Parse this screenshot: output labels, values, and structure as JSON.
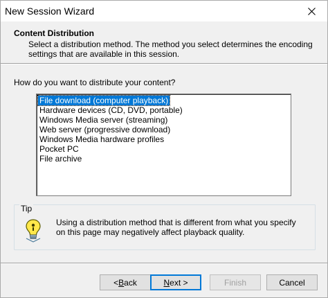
{
  "window": {
    "title": "New Session Wizard"
  },
  "header": {
    "title": "Content Distribution",
    "description": "Select a distribution method. The method you select determines the encoding settings that are available in this session."
  },
  "question": "How do you want to distribute your content?",
  "methods": [
    "File download (computer playback)",
    "Hardware devices (CD, DVD, portable)",
    "Windows Media server (streaming)",
    "Web server (progressive download)",
    "Windows Media hardware profiles",
    "Pocket PC",
    "File archive"
  ],
  "selected_index": 0,
  "tip": {
    "label": "Tip",
    "text": "Using a distribution method that is different from what you specify on this page may negatively affect playback quality.",
    "icon": "lightbulb-icon"
  },
  "buttons": {
    "back": {
      "prefix": "< ",
      "mnemonic": "B",
      "rest": "ack"
    },
    "next": {
      "mnemonic": "N",
      "rest": "ext >"
    },
    "finish": "Finish",
    "cancel": "Cancel"
  },
  "colors": {
    "selection": "#0078d7",
    "dialog_bg": "#f0f0f0"
  }
}
